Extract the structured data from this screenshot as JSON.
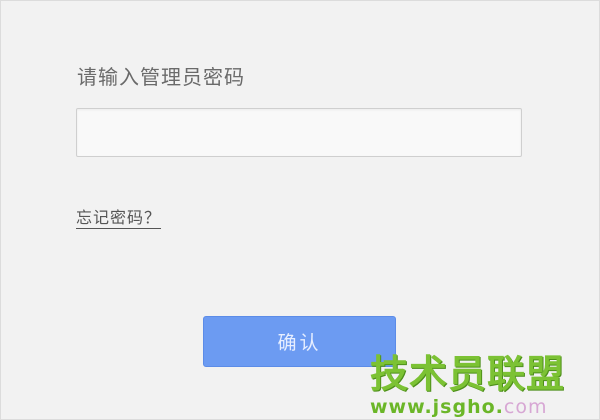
{
  "dialog": {
    "prompt_label": "请输入管理员密码",
    "password_input": {
      "value": "",
      "placeholder": ""
    },
    "forgot_link": "忘记密码？",
    "confirm_button": "确认"
  },
  "watermark": {
    "title": "技术员联盟",
    "url_main": "www.jsgho.",
    "url_suffix": "com"
  },
  "colors": {
    "background": "#f2f2f2",
    "button": "#6c9bf2",
    "watermark_green": "#7cc234",
    "watermark_pink": "#d7a7d4"
  }
}
